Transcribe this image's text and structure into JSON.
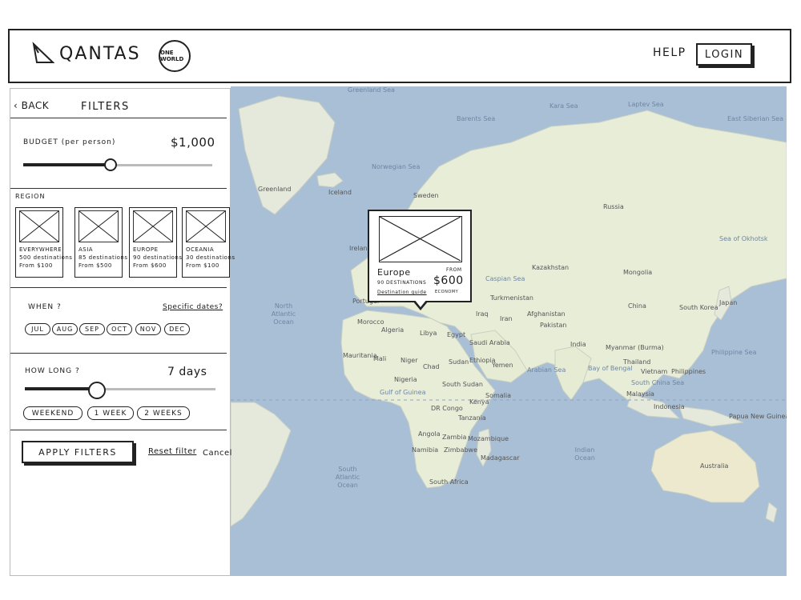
{
  "header": {
    "logo_text": "QANTAS",
    "alliance_badge": "ONE WORLD",
    "help_label": "HELP",
    "login_label": "LOGIN"
  },
  "filters": {
    "back_label": "BACK",
    "title": "FILTERS",
    "budget": {
      "label": "BUDGET (per person)",
      "value_text": "$1,000",
      "slider_fraction": 0.46
    },
    "region": {
      "label": "REGION",
      "cards": [
        {
          "name": "EVERYWHERE",
          "destinations": "500 destinations",
          "price": "From $100"
        },
        {
          "name": "ASIA",
          "destinations": "85 destinations",
          "price": "From $500"
        },
        {
          "name": "EUROPE",
          "destinations": "90 destinations",
          "price": "From $600"
        },
        {
          "name": "OCEANIA",
          "destinations": "30 destinations",
          "price": "From $100"
        }
      ]
    },
    "when": {
      "label": "WHEN ?",
      "specific_dates": "Specific dates?",
      "months": [
        "JUL",
        "AUG",
        "SEP",
        "OCT",
        "NOV",
        "DEC"
      ]
    },
    "how_long": {
      "label": "HOW LONG ?",
      "value_text": "7 days",
      "slider_fraction": 0.38,
      "options": [
        "WEEKEND",
        "1 WEEK",
        "2 WEEKS"
      ]
    },
    "apply_label": "APPLY FILTERS",
    "reset_label": "Reset filter",
    "cancel_label": "Cancel"
  },
  "popup": {
    "region": "Europe",
    "destinations": "90 DESTINATIONS",
    "link": "Destination guide",
    "from_label": "FROM",
    "price": "$600",
    "price_note": "ECONOMY"
  },
  "map": {
    "labels": {
      "greenland": "Greenland",
      "iceland": "Iceland",
      "sweden": "Sweden",
      "russia": "Russia",
      "kazakhstan": "Kazakhstan",
      "mongolia": "Mongolia",
      "china": "China",
      "japan": "Japan",
      "south_korea": "South Korea",
      "ireland": "Ireland",
      "portugal": "Portugal",
      "morocco": "Morocco",
      "algeria": "Algeria",
      "libya": "Libya",
      "egypt": "Egypt",
      "turkmenistan": "Turkmenistan",
      "afghanistan": "Afghanistan",
      "pakistan": "Pakistan",
      "iran": "Iran",
      "iraq": "Iraq",
      "saudi_arabia": "Saudi Arabia",
      "india": "India",
      "myanmar": "Myanmar (Burma)",
      "thailand": "Thailand",
      "vietnam": "Vietnam",
      "philippines": "Philippines",
      "malaysia": "Malaysia",
      "indonesia": "Indonesia",
      "papua": "Papua New Guinea",
      "australia": "Australia",
      "mauritania": "Mauritania",
      "mali": "Mali",
      "niger": "Niger",
      "chad": "Chad",
      "sudan": "Sudan",
      "south_sudan": "South Sudan",
      "ethiopia": "Ethiopia",
      "somalia": "Somalia",
      "kenya": "Kenya",
      "nigeria": "Nigeria",
      "yemen": "Yemen",
      "dr_congo": "DR Congo",
      "tanzania": "Tanzania",
      "angola": "Angola",
      "zambia": "Zambia",
      "mozambique": "Mozambique",
      "namibia": "Namibia",
      "zimbabwe": "Zimbabwe",
      "madagascar": "Madagascar",
      "south_africa": "South Africa",
      "north_atlantic": "North Atlantic Ocean",
      "south_atlantic": "South Atlantic Ocean",
      "indian_ocean": "Indian Ocean",
      "arabian_sea": "Arabian Sea",
      "bay_of_bengal": "Bay of Bengal",
      "norwegian_sea": "Norwegian Sea",
      "greenland_sea": "Greenland Sea",
      "barents_sea": "Barents Sea",
      "kara_sea": "Kara Sea",
      "laptev_sea": "Laptev Sea",
      "east_siberian_sea": "East Siberian Sea",
      "philippine_sea": "Philippine Sea",
      "south_china_sea": "South China Sea",
      "gulf_of_guinea": "Gulf of Guinea",
      "sea_of_okhotsk": "Sea of Okhotsk",
      "caspian_sea": "Caspian Sea"
    }
  }
}
